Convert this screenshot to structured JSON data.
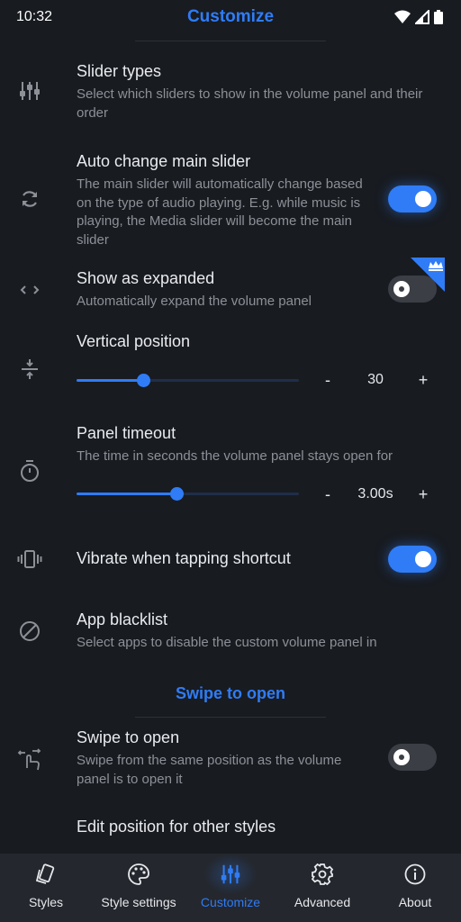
{
  "status": {
    "time": "10:32"
  },
  "header": {
    "title": "Customize"
  },
  "rows": {
    "slider_types": {
      "title": "Slider types",
      "desc": "Select which sliders to show in the volume panel and their order"
    },
    "auto_change": {
      "title": "Auto change main slider",
      "desc": "The main slider will automatically change based on the type of audio playing. E.g. while music is playing, the Media slider will become the main slider",
      "enabled": true
    },
    "expanded": {
      "title": "Show as expanded",
      "desc": "Automatically expand the volume panel",
      "enabled": false
    },
    "vertical": {
      "title": "Vertical position",
      "value": "30",
      "minus": "-",
      "plus": "+",
      "slider_fraction": 0.3
    },
    "timeout": {
      "title": "Panel timeout",
      "desc": "The time in seconds the volume panel stays open for",
      "value": "3.00s",
      "minus": "-",
      "plus": "+",
      "slider_fraction": 0.45
    },
    "vibrate": {
      "title": "Vibrate when tapping shortcut",
      "enabled": true
    },
    "blacklist": {
      "title": "App blacklist",
      "desc": "Select apps to disable the custom volume panel in"
    },
    "swipe": {
      "title": "Swipe to open",
      "desc": "Swipe from the same position as the volume panel is to open it",
      "enabled": false
    },
    "edit_position": {
      "title": "Edit position for other styles"
    }
  },
  "section": {
    "swipe_header": "Swipe to open"
  },
  "nav": {
    "items": [
      {
        "label": "Styles",
        "icon": "styles-icon"
      },
      {
        "label": "Style settings",
        "icon": "palette-icon"
      },
      {
        "label": "Customize",
        "icon": "sliders-icon",
        "active": true
      },
      {
        "label": "Advanced",
        "icon": "gear-icon"
      },
      {
        "label": "About",
        "icon": "info-icon"
      }
    ]
  },
  "colors": {
    "accent": "#2f7cf6",
    "background": "#181b20",
    "nav_background": "#24272d"
  }
}
